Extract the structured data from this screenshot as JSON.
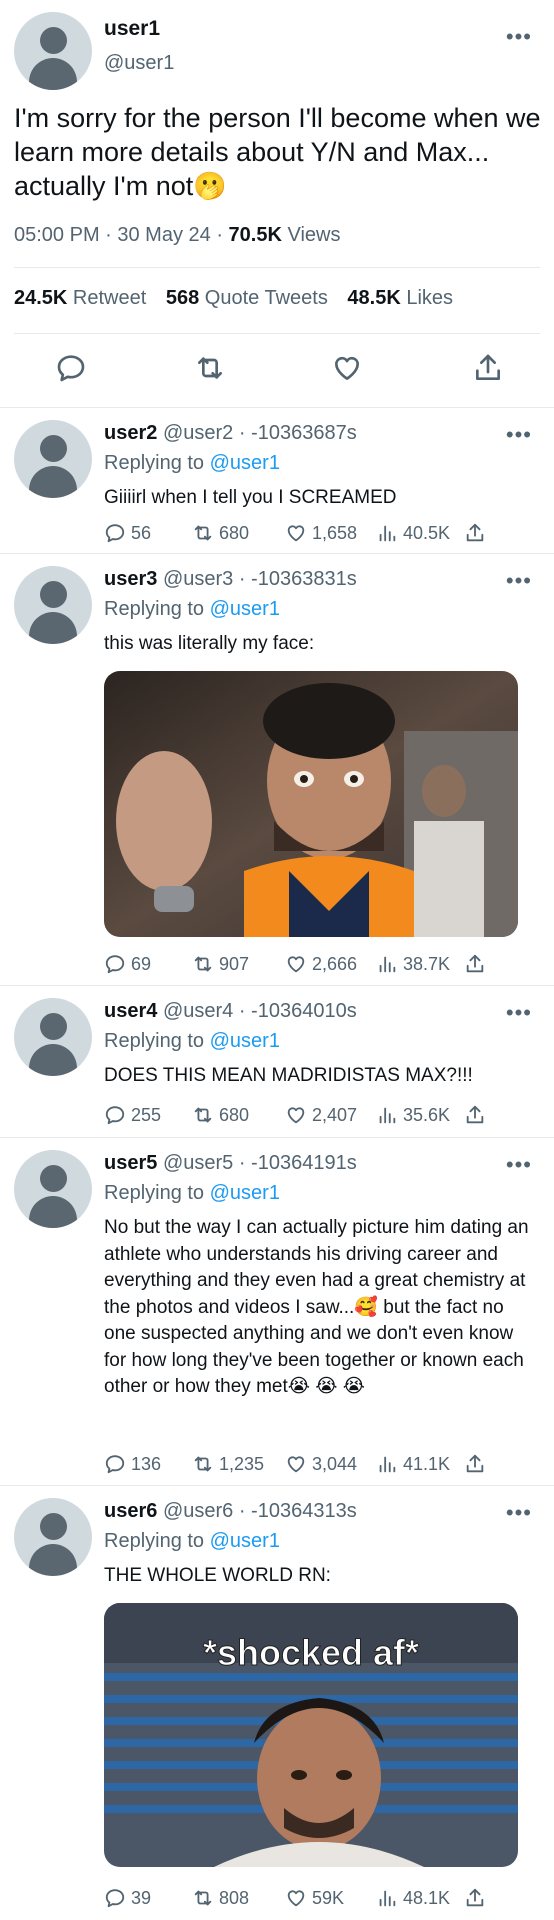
{
  "main_tweet": {
    "display_name": "user1",
    "handle": "@user1",
    "text": "I'm sorry for the person I'll become when we learn more details about Y/N and Max... actually I'm not🫢",
    "time": "05:00 PM · 30 May 24 · ",
    "views_count": "70.5K",
    "views_label": " Views",
    "retweets_count": "24.5K",
    "retweets_label": " Retweet",
    "quotes_count": "568",
    "quotes_label": " Quote Tweets",
    "likes_count": "48.5K",
    "likes_label": " Likes",
    "more_label": "•••"
  },
  "replies": [
    {
      "name": "user2",
      "handle": "@user2",
      "timestamp": " · -10363687s",
      "replying_prefix": "Replying to ",
      "replying_to": "@user1",
      "text": "Giiiirl when I tell you I SCREAMED",
      "replies": "56",
      "retweets": "680",
      "likes": "1,658",
      "views": "40.5K",
      "more_label": "•••"
    },
    {
      "name": "user3",
      "handle": "@user3",
      "timestamp": " · -10363831s",
      "replying_prefix": "Replying to ",
      "replying_to": "@user1",
      "text": "this was literally my face:",
      "replies": "69",
      "retweets": "907",
      "likes": "2,666",
      "views": "38.7K",
      "more_label": "•••"
    },
    {
      "name": "user4",
      "handle": "@user4",
      "timestamp": " · -10364010s",
      "replying_prefix": "Replying to ",
      "replying_to": "@user1",
      "text": "DOES THIS MEAN MADRIDISTAS MAX?!!!",
      "replies": "255",
      "retweets": "680",
      "likes": "2,407",
      "views": "35.6K",
      "more_label": "•••"
    },
    {
      "name": "user5",
      "handle": "@user5",
      "timestamp": " · -10364191s",
      "replying_prefix": "Replying to ",
      "replying_to": "@user1",
      "text": "No but the way I can actually picture him dating an athlete who understands his driving career and everything and they even had a great chemistry at the photos and videos I saw...🥰  but the fact no one suspected anything and we don't even know for how long they've been together or known each other or how they met😭 😭 😭",
      "replies": "136",
      "retweets": "1,235",
      "likes": "3,044",
      "views": "41.1K",
      "more_label": "•••"
    },
    {
      "name": "user6",
      "handle": "@user6",
      "timestamp": " · -10364313s",
      "replying_prefix": "Replying to ",
      "replying_to": "@user1",
      "text": "THE WHOLE WORLD RN:",
      "media_caption": "*shocked af*",
      "replies": "39",
      "retweets": "808",
      "likes": "59K",
      "views": "48.1K",
      "more_label": "•••"
    }
  ],
  "icons": {
    "reply": "speech-bubble-icon",
    "retweet": "retweet-arrows-icon",
    "like": "heart-icon",
    "views": "bar-chart-icon",
    "share": "share-upload-icon"
  },
  "colors": {
    "link": "#1d9bf0",
    "muted": "#536471",
    "text": "#0f1419",
    "divider": "#e7e9ea"
  }
}
